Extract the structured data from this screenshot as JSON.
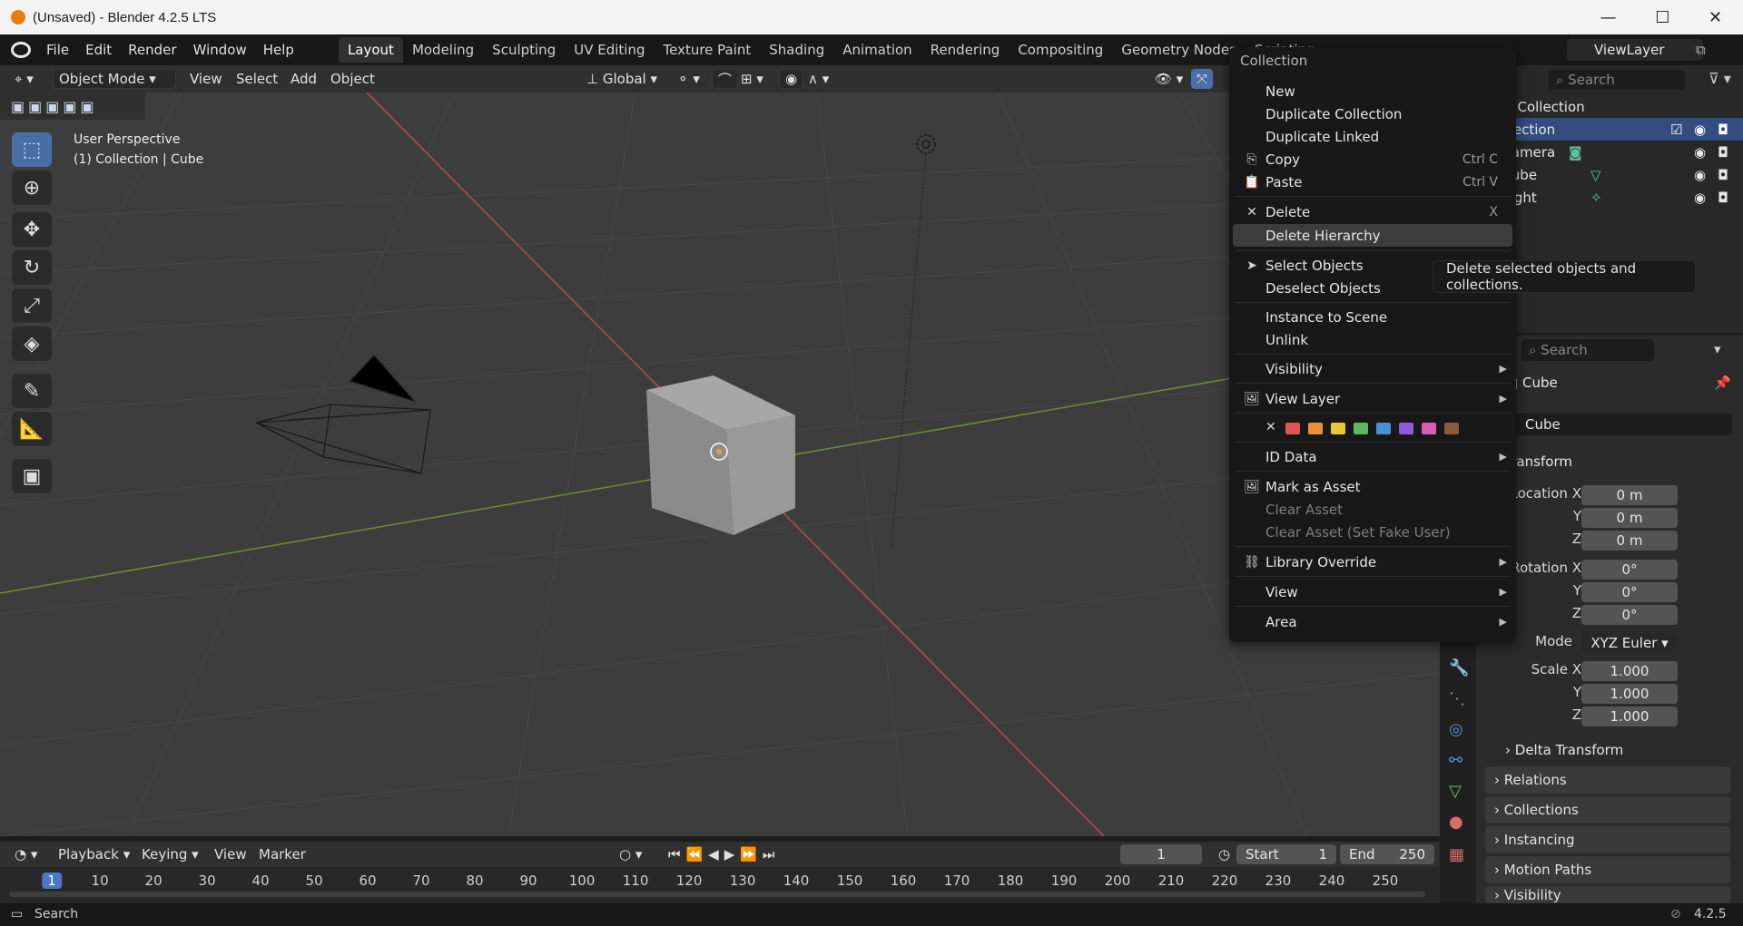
{
  "window": {
    "title": "(Unsaved) - Blender 4.2.5 LTS",
    "minimize": "—",
    "maximize": "☐",
    "close": "✕"
  },
  "menu": [
    "File",
    "Edit",
    "Render",
    "Window",
    "Help"
  ],
  "workspaces": [
    "Layout",
    "Modeling",
    "Sculpting",
    "UV Editing",
    "Texture Paint",
    "Shading",
    "Animation",
    "Rendering",
    "Compositing",
    "Geometry Nodes",
    "Scripting"
  ],
  "active_workspace": "Layout",
  "view_layer": "ViewLayer",
  "viewport_header": {
    "mode": "Object Mode",
    "view": "View",
    "select": "Select",
    "add": "Add",
    "object": "Object",
    "orientation": "Global"
  },
  "viewport_overlay": {
    "perspective": "User Perspective",
    "context": "(1) Collection | Cube"
  },
  "outliner": {
    "search_placeholder": "Search",
    "scene_collection": "Scene Collection",
    "items": [
      {
        "label": "Collection"
      },
      {
        "label": "Camera"
      },
      {
        "label": "Cube"
      },
      {
        "label": "Light"
      }
    ]
  },
  "context_menu": {
    "title": "Collection",
    "new": "New",
    "duplicate_collection": "Duplicate Collection",
    "duplicate_linked": "Duplicate Linked",
    "copy": "Copy",
    "copy_sc": "Ctrl C",
    "paste": "Paste",
    "paste_sc": "Ctrl V",
    "delete": "Delete",
    "delete_sc": "X",
    "delete_hierarchy": "Delete Hierarchy",
    "select_objects": "Select Objects",
    "deselect_objects": "Deselect Objects",
    "instance_to_scene": "Instance to Scene",
    "unlink": "Unlink",
    "visibility": "Visibility",
    "view_layer": "View Layer",
    "id_data": "ID Data",
    "mark_as_asset": "Mark as Asset",
    "clear_asset": "Clear Asset",
    "clear_asset_fake": "Clear Asset (Set Fake User)",
    "library_override": "Library Override",
    "view": "View",
    "area": "Area",
    "color_tags": [
      "#e05656",
      "#e6923a",
      "#e6c83a",
      "#5cb85c",
      "#4a8fd6",
      "#8e5cd6",
      "#d65cb4",
      "#8a5a3c"
    ]
  },
  "tooltip": "Delete selected objects and collections.",
  "properties": {
    "search_placeholder": "Search",
    "object_name": "Cube",
    "object_field": "Cube",
    "transform": "Transform",
    "location_x_label": "Location X",
    "location_y_label": "Y",
    "location_z_label": "Z",
    "location": [
      "0 m",
      "0 m",
      "0 m"
    ],
    "rotation_x_label": "Rotation X",
    "rotation_y_label": "Y",
    "rotation_z_label": "Z",
    "rotation": [
      "0°",
      "0°",
      "0°"
    ],
    "mode_label": "Mode",
    "mode": "XYZ Euler",
    "scale_x_label": "Scale X",
    "scale_y_label": "Y",
    "scale_z_label": "Z",
    "scale": [
      "1.000",
      "1.000",
      "1.000"
    ],
    "delta_transform": "Delta Transform",
    "relations": "Relations",
    "collections": "Collections",
    "instancing": "Instancing",
    "motion_paths": "Motion Paths",
    "visibility": "Visibility"
  },
  "timeline": {
    "playback": "Playback",
    "keying": "Keying",
    "view": "View",
    "marker": "Marker",
    "current_frame": "1",
    "start_label": "Start",
    "start": "1",
    "end_label": "End",
    "end": "250",
    "ticks": [
      "1",
      "10",
      "20",
      "30",
      "40",
      "50",
      "60",
      "70",
      "80",
      "90",
      "100",
      "110",
      "120",
      "130",
      "140",
      "150",
      "160",
      "170",
      "180",
      "190",
      "200",
      "210",
      "220",
      "230",
      "240",
      "250"
    ]
  },
  "statusbar": {
    "search": "Search",
    "version": "4.2.5"
  }
}
